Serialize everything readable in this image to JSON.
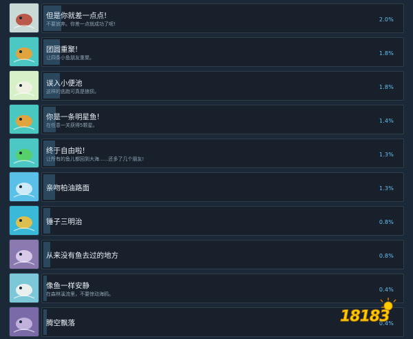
{
  "achievements": [
    {
      "title": "但是你就差一点点!",
      "desc": "不要放弃。你差一点就成功了呢!",
      "pct": "2.0%",
      "percent_value": 2.0,
      "colors": [
        "#c9d9d6",
        "#b84a3a"
      ]
    },
    {
      "title": "团圆重聚!",
      "desc": "让四条小鱼朋友重聚。",
      "pct": "1.8%",
      "percent_value": 1.8,
      "colors": [
        "#4cc8c4",
        "#f0a030"
      ]
    },
    {
      "title": "误入小便池",
      "desc": "这样的逃跑可真是狼狈。",
      "pct": "1.8%",
      "percent_value": 1.8,
      "colors": [
        "#d8f0c8",
        "#f2f2e6"
      ]
    },
    {
      "title": "你是一条明星鱼!",
      "desc": "在任意一关获得5颗星。",
      "pct": "1.4%",
      "percent_value": 1.4,
      "colors": [
        "#48c8c0",
        "#f0a030"
      ]
    },
    {
      "title": "终于自由啦!",
      "desc": "让所有的鱼儿都回到大海......还多了几个朋友!",
      "pct": "1.3%",
      "percent_value": 1.3,
      "colors": [
        "#4cc8c4",
        "#58d060"
      ]
    },
    {
      "title": "亲吻柏油路面",
      "desc": "",
      "pct": "1.3%",
      "percent_value": 1.3,
      "colors": [
        "#5bc0e8",
        "#d8eef8"
      ]
    },
    {
      "title": "锤子三明治",
      "desc": "",
      "pct": "0.8%",
      "percent_value": 0.8,
      "colors": [
        "#3ab8d8",
        "#f0c040"
      ]
    },
    {
      "title": "从来没有鱼去过的地方",
      "desc": "",
      "pct": "0.8%",
      "percent_value": 0.8,
      "colors": [
        "#8a7ab0",
        "#e0d0f0"
      ]
    },
    {
      "title": "像鱼一样安静",
      "desc": "在森林溪流里，不要惊动海鸥。",
      "pct": "0.4%",
      "percent_value": 0.4,
      "colors": [
        "#7cc8d8",
        "#f4f4f0"
      ]
    },
    {
      "title": "腾空飘落",
      "desc": "",
      "pct": "0.4%",
      "percent_value": 0.4,
      "colors": [
        "#7a6aa8",
        "#c8b8e0"
      ]
    }
  ],
  "watermark": {
    "text": "18183"
  }
}
